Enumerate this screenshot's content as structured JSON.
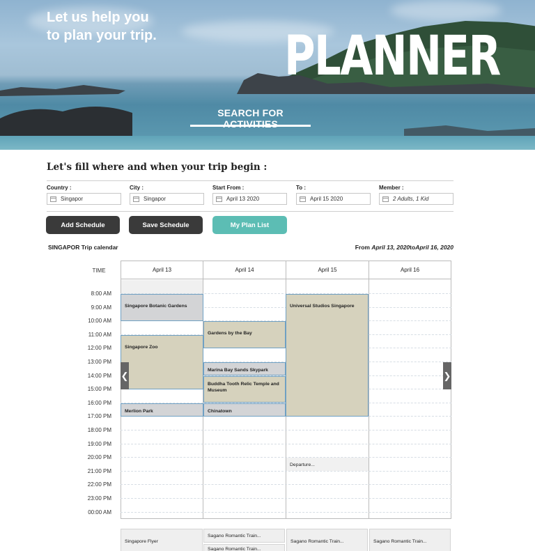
{
  "hero": {
    "tagline": "Let us help you\nto plan your trip.",
    "title": "PLANNER",
    "search_link": "SEARCH FOR ACTIVITIES"
  },
  "form": {
    "heading": "Let's fill where and when your trip begin :",
    "fields": [
      {
        "label": "Country :",
        "value": "Singapor",
        "icon": "flag-icon"
      },
      {
        "label": "City :",
        "value": "Singapor",
        "icon": "city-icon"
      },
      {
        "label": "Start From :",
        "value": "April 13 2020",
        "icon": "calendar-icon"
      },
      {
        "label": "To :",
        "value": "April 15 2020",
        "icon": "calendar-icon"
      },
      {
        "label": "Member :",
        "value": "2 Adults, 1 Kid",
        "icon": "people-icon"
      }
    ],
    "buttons": {
      "add": "Add Schedule",
      "save": "Save Schedule",
      "plan": "My Plan List"
    }
  },
  "calendar": {
    "title": "SINGAPOR Trip calendar",
    "range_prefix": "From ",
    "range_start": "April 13, 2020",
    "range_mid": "to",
    "range_end": "April 16, 2020",
    "time_header": "TIME",
    "days": [
      "April 13",
      "April 14",
      "April 15",
      "April 16"
    ],
    "times": [
      "8:00 AM",
      "9:00 AM",
      "10:00 AM",
      "11:00 AM",
      "12:00 PM",
      "13:00 PM",
      "14:00 PM",
      "15:00 PM",
      "16:00 PM",
      "17:00 PM",
      "18:00 PM",
      "19:00 PM",
      "20:00 PM",
      "21:00 PM",
      "22:00 PM",
      "23:00 PM",
      "00:00 AM"
    ],
    "events": [
      {
        "day": "April 13",
        "title": "Singapore Botanic Gardens",
        "start": "9:00 AM",
        "end": "11:00 AM"
      },
      {
        "day": "April 13",
        "title": "Singapore Zoo",
        "start": "12:00 PM",
        "end": "16:00 PM"
      },
      {
        "day": "April 13",
        "title": "Merlion Park",
        "start": "17:00 PM",
        "end": "18:00 PM"
      },
      {
        "day": "April 14",
        "title": "Gardens by the Bay",
        "start": "11:00 AM",
        "end": "13:00 PM"
      },
      {
        "day": "April 14",
        "title": "Marina Bay Sands Skypark",
        "start": "14:00 PM",
        "end": "15:00 PM"
      },
      {
        "day": "April 14",
        "title": "Buddha Tooth Relic Temple and Museum",
        "start": "15:00 PM",
        "end": "17:00 PM"
      },
      {
        "day": "April 14",
        "title": "Chinatown",
        "start": "17:00 PM",
        "end": "18:00 PM"
      },
      {
        "day": "April 15",
        "title": "Universal Studios Singapore",
        "start": "9:00 AM",
        "end": "18:00 PM"
      },
      {
        "day": "April 15",
        "title": "Departure...",
        "start": "21:00 PM",
        "end": "22:00 PM"
      }
    ],
    "suggestions": [
      "Singapore Flyer",
      "Sagano Romantic Train...",
      "Sagano Romantic Train...",
      "Sagano Romantic Train...",
      "Sagano Romantic Train..."
    ],
    "colors": {
      "event_tan": "#d6d2bd",
      "event_grey": "#d3d4d6",
      "event_border": "#6fa0c3",
      "teal": "#5cbdb4",
      "dark": "#3a3a3a"
    }
  }
}
